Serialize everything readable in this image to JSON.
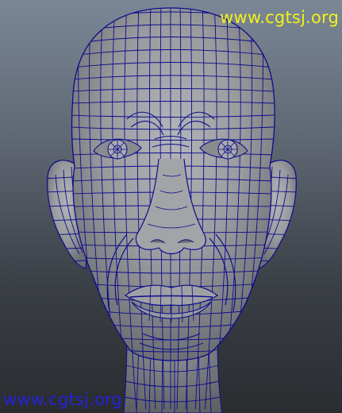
{
  "viewport": {
    "background_top": "#7b8796",
    "background_bottom": "#2a2c30",
    "mesh_surface": "#9a9b9e",
    "wire_color": "#0c0c8c"
  },
  "watermarks": {
    "top_text": "www.cgtsj.org",
    "top_color": "#f2f21a",
    "bottom_text": "www.cgtsj.org",
    "bottom_color": "#2323d8"
  }
}
